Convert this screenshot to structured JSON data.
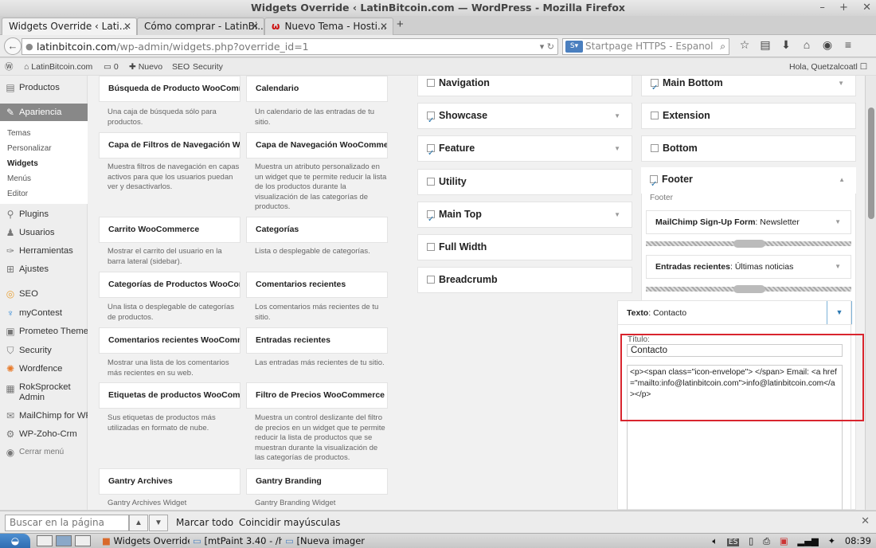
{
  "window": {
    "title": "Widgets Override ‹ LatinBitcoin.com — WordPress - Mozilla Firefox"
  },
  "window_controls": [
    "–",
    "+",
    "✕"
  ],
  "tabs": [
    {
      "label": "Widgets Override ‹ Lati...",
      "active": true
    },
    {
      "label": "Cómo comprar - LatinBi...",
      "active": false
    },
    {
      "label": "Nuevo Tema - Hosti...",
      "active": false
    }
  ],
  "url": {
    "host": "latinbitcoin.com",
    "path": "/wp-admin/widgets.php?override_id=1"
  },
  "search": {
    "placeholder": "Startpage HTTPS - Espanol"
  },
  "adminbar": {
    "site": "LatinBitcoin.com",
    "comments": "0",
    "new": "Nuevo",
    "seo": "SEO",
    "security": "Security",
    "greeting": "Hola, Quetzalcoatl"
  },
  "sidebar": {
    "productos": "Productos",
    "apariencia": "Apariencia",
    "submenu": [
      "Temas",
      "Personalizar",
      "Widgets",
      "Menús",
      "Editor"
    ],
    "items": [
      "Plugins",
      "Usuarios",
      "Herramientas",
      "Ajustes",
      "SEO",
      "myContest",
      "Prometeo Theme",
      "Security",
      "Wordfence",
      "RokSprocket Admin",
      "MailChimp for WP",
      "WP-Zoho-Crm"
    ],
    "collapse": "Cerrar menú"
  },
  "widgets": [
    {
      "title": "Búsqueda de Producto WooComm...",
      "desc": "Una caja de búsqueda sólo para productos."
    },
    {
      "title": "Calendario",
      "desc": "Un calendario de las entradas de tu sitio."
    },
    {
      "title": "Capa de Filtros de Navegación Wo...",
      "desc": "Muestra filtros de navegación en capas activos para que los usuarios puedan ver y desactivarlos."
    },
    {
      "title": "Capa de Navegación WooCommerce",
      "desc": "Muestra un atributo personalizado en un widget que te permite reducir la lista de los productos durante la visualización de las categorías de productos."
    },
    {
      "title": "Carrito WooCommerce",
      "desc": "Mostrar el carrito del usuario en la barra lateral (sidebar)."
    },
    {
      "title": "Categorías",
      "desc": "Lista o desplegable de categorías."
    },
    {
      "title": "Categorías de Productos WooCom...",
      "desc": "Una lista o desplegable de categorías de productos."
    },
    {
      "title": "Comentarios recientes",
      "desc": "Los comentarios más recientes de tu sitio."
    },
    {
      "title": "Comentarios recientes WooComm...",
      "desc": "Mostrar una lista de los comentarios más recientes en su web."
    },
    {
      "title": "Entradas recientes",
      "desc": "Las entradas más recientes de tu sitio."
    },
    {
      "title": "Etiquetas de productos WooCom...",
      "desc": "Sus etiquetas de productos más utilizadas en formato de nube."
    },
    {
      "title": "Filtro de Precios WooCommerce",
      "desc": "Muestra un control deslizante del filtro de precios en un widget que te permite reducir la lista de productos que se muestran durante la visualización de las categorías de productos."
    },
    {
      "title": "Gantry Archives",
      "desc": "Gantry Archives Widget"
    },
    {
      "title": "Gantry Branding",
      "desc": "Gantry Branding Widget"
    }
  ],
  "areas_col1": [
    {
      "label": "Navigation",
      "checked": false,
      "arrow": false
    },
    {
      "label": "Showcase",
      "checked": true,
      "arrow": true
    },
    {
      "label": "Feature",
      "checked": true,
      "arrow": true
    },
    {
      "label": "Utility",
      "checked": false,
      "arrow": false
    },
    {
      "label": "Main Top",
      "checked": true,
      "arrow": true
    },
    {
      "label": "Full Width",
      "checked": false,
      "arrow": false
    },
    {
      "label": "Breadcrumb",
      "checked": false,
      "arrow": false
    }
  ],
  "areas_col2": [
    {
      "label": "Main Bottom",
      "checked": true,
      "arrow": true
    },
    {
      "label": "Extension",
      "checked": false,
      "arrow": false
    },
    {
      "label": "Bottom",
      "checked": false,
      "arrow": false
    }
  ],
  "footer": {
    "label": "Footer",
    "checked": true,
    "subtitle": "Footer",
    "widgets": [
      {
        "name": "MailChimp Sign-Up Form",
        "title": "Newsletter"
      },
      {
        "name": "Entradas recientes",
        "title": "Últimas noticias"
      }
    ]
  },
  "texto_widget": {
    "name": "Texto",
    "title": "Contacto",
    "titulo_label": "Título:",
    "titulo_value": "Contacto",
    "content": "<p><span class=\"icon-envelope\"> </span> Email: <a href=\"mailto:info@latinbitcoin.com\">info@latinbitcoin.com</a></p>"
  },
  "findbar": {
    "placeholder": "Buscar en la página",
    "highlight": "Marcar todo",
    "match_case": "Coincidir mayúsculas"
  },
  "taskbar": {
    "apps": [
      "Widgets Override ...",
      "[mtPaint 3.40 - /h...",
      "[Nueva imagen]"
    ],
    "lang": "ES",
    "clock": "08:39"
  }
}
